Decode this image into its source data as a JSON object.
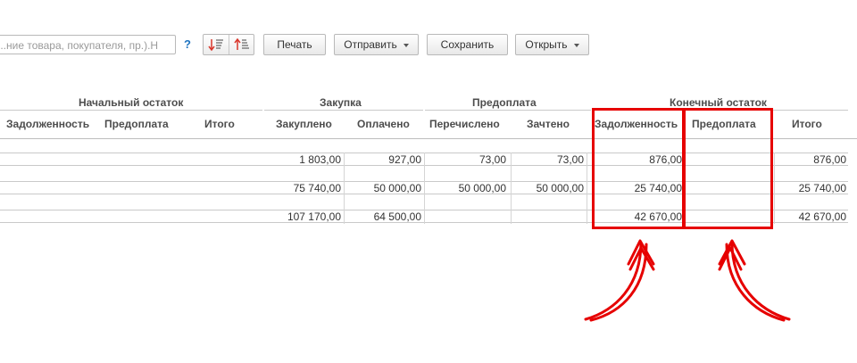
{
  "toolbar": {
    "search_text": "ние товара, покупателя, пр.).Н...",
    "help_label": "?",
    "print_label": "Печать",
    "send_label": "Отправить",
    "save_label": "Сохранить",
    "open_label": "Открыть"
  },
  "table": {
    "group_headers": {
      "initial": "Начальный остаток",
      "purchase": "Закупка",
      "prepayment": "Предоплата",
      "final": "Конечный остаток"
    },
    "columns": {
      "debt": "Задолженность",
      "prepay": "Предоплата",
      "total": "Итого",
      "purchased": "Закуплено",
      "paid": "Оплачено",
      "transferred": "Перечислено",
      "offset": "Зачтено",
      "final_debt": "Задолженность",
      "final_prepay": "Предоплата",
      "final_total": "Итого"
    },
    "rows": [
      {
        "purchased": "1 803,00",
        "paid": "927,00",
        "transferred": "73,00",
        "offset": "73,00",
        "final_debt": "876,00",
        "final_prepay": "",
        "final_total": "876,00"
      },
      {
        "purchased": "75 740,00",
        "paid": "50 000,00",
        "transferred": "50 000,00",
        "offset": "50 000,00",
        "final_debt": "25 740,00",
        "final_prepay": "",
        "final_total": "25 740,00"
      },
      {
        "purchased": "107 170,00",
        "paid": "64 500,00",
        "transferred": "",
        "offset": "",
        "final_debt": "42 670,00",
        "final_prepay": "",
        "final_total": "42 670,00"
      }
    ]
  },
  "annotation": {
    "color": "#e60000"
  }
}
